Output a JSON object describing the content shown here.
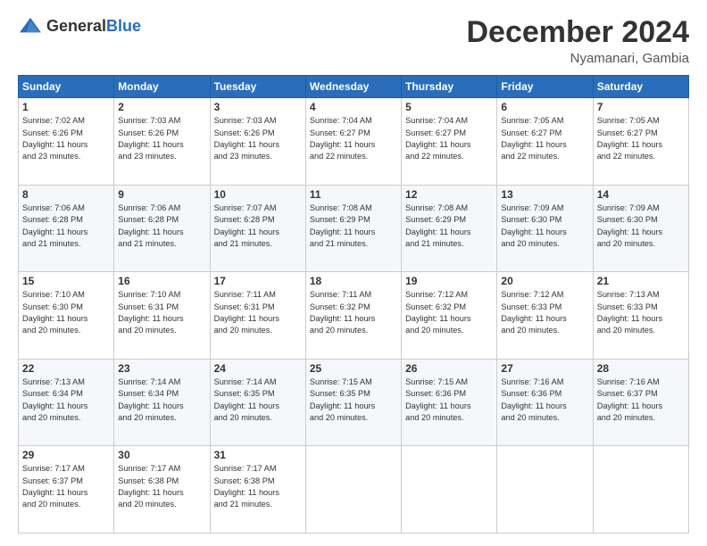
{
  "logo": {
    "general": "General",
    "blue": "Blue"
  },
  "header": {
    "month": "December 2024",
    "location": "Nyamanari, Gambia"
  },
  "weekdays": [
    "Sunday",
    "Monday",
    "Tuesday",
    "Wednesday",
    "Thursday",
    "Friday",
    "Saturday"
  ],
  "weeks": [
    [
      {
        "day": "1",
        "info": "Sunrise: 7:02 AM\nSunset: 6:26 PM\nDaylight: 11 hours\nand 23 minutes."
      },
      {
        "day": "2",
        "info": "Sunrise: 7:03 AM\nSunset: 6:26 PM\nDaylight: 11 hours\nand 23 minutes."
      },
      {
        "day": "3",
        "info": "Sunrise: 7:03 AM\nSunset: 6:26 PM\nDaylight: 11 hours\nand 23 minutes."
      },
      {
        "day": "4",
        "info": "Sunrise: 7:04 AM\nSunset: 6:27 PM\nDaylight: 11 hours\nand 22 minutes."
      },
      {
        "day": "5",
        "info": "Sunrise: 7:04 AM\nSunset: 6:27 PM\nDaylight: 11 hours\nand 22 minutes."
      },
      {
        "day": "6",
        "info": "Sunrise: 7:05 AM\nSunset: 6:27 PM\nDaylight: 11 hours\nand 22 minutes."
      },
      {
        "day": "7",
        "info": "Sunrise: 7:05 AM\nSunset: 6:27 PM\nDaylight: 11 hours\nand 22 minutes."
      }
    ],
    [
      {
        "day": "8",
        "info": "Sunrise: 7:06 AM\nSunset: 6:28 PM\nDaylight: 11 hours\nand 21 minutes."
      },
      {
        "day": "9",
        "info": "Sunrise: 7:06 AM\nSunset: 6:28 PM\nDaylight: 11 hours\nand 21 minutes."
      },
      {
        "day": "10",
        "info": "Sunrise: 7:07 AM\nSunset: 6:28 PM\nDaylight: 11 hours\nand 21 minutes."
      },
      {
        "day": "11",
        "info": "Sunrise: 7:08 AM\nSunset: 6:29 PM\nDaylight: 11 hours\nand 21 minutes."
      },
      {
        "day": "12",
        "info": "Sunrise: 7:08 AM\nSunset: 6:29 PM\nDaylight: 11 hours\nand 21 minutes."
      },
      {
        "day": "13",
        "info": "Sunrise: 7:09 AM\nSunset: 6:30 PM\nDaylight: 11 hours\nand 20 minutes."
      },
      {
        "day": "14",
        "info": "Sunrise: 7:09 AM\nSunset: 6:30 PM\nDaylight: 11 hours\nand 20 minutes."
      }
    ],
    [
      {
        "day": "15",
        "info": "Sunrise: 7:10 AM\nSunset: 6:30 PM\nDaylight: 11 hours\nand 20 minutes."
      },
      {
        "day": "16",
        "info": "Sunrise: 7:10 AM\nSunset: 6:31 PM\nDaylight: 11 hours\nand 20 minutes."
      },
      {
        "day": "17",
        "info": "Sunrise: 7:11 AM\nSunset: 6:31 PM\nDaylight: 11 hours\nand 20 minutes."
      },
      {
        "day": "18",
        "info": "Sunrise: 7:11 AM\nSunset: 6:32 PM\nDaylight: 11 hours\nand 20 minutes."
      },
      {
        "day": "19",
        "info": "Sunrise: 7:12 AM\nSunset: 6:32 PM\nDaylight: 11 hours\nand 20 minutes."
      },
      {
        "day": "20",
        "info": "Sunrise: 7:12 AM\nSunset: 6:33 PM\nDaylight: 11 hours\nand 20 minutes."
      },
      {
        "day": "21",
        "info": "Sunrise: 7:13 AM\nSunset: 6:33 PM\nDaylight: 11 hours\nand 20 minutes."
      }
    ],
    [
      {
        "day": "22",
        "info": "Sunrise: 7:13 AM\nSunset: 6:34 PM\nDaylight: 11 hours\nand 20 minutes."
      },
      {
        "day": "23",
        "info": "Sunrise: 7:14 AM\nSunset: 6:34 PM\nDaylight: 11 hours\nand 20 minutes."
      },
      {
        "day": "24",
        "info": "Sunrise: 7:14 AM\nSunset: 6:35 PM\nDaylight: 11 hours\nand 20 minutes."
      },
      {
        "day": "25",
        "info": "Sunrise: 7:15 AM\nSunset: 6:35 PM\nDaylight: 11 hours\nand 20 minutes."
      },
      {
        "day": "26",
        "info": "Sunrise: 7:15 AM\nSunset: 6:36 PM\nDaylight: 11 hours\nand 20 minutes."
      },
      {
        "day": "27",
        "info": "Sunrise: 7:16 AM\nSunset: 6:36 PM\nDaylight: 11 hours\nand 20 minutes."
      },
      {
        "day": "28",
        "info": "Sunrise: 7:16 AM\nSunset: 6:37 PM\nDaylight: 11 hours\nand 20 minutes."
      }
    ],
    [
      {
        "day": "29",
        "info": "Sunrise: 7:17 AM\nSunset: 6:37 PM\nDaylight: 11 hours\nand 20 minutes."
      },
      {
        "day": "30",
        "info": "Sunrise: 7:17 AM\nSunset: 6:38 PM\nDaylight: 11 hours\nand 20 minutes."
      },
      {
        "day": "31",
        "info": "Sunrise: 7:17 AM\nSunset: 6:38 PM\nDaylight: 11 hours\nand 21 minutes."
      },
      null,
      null,
      null,
      null
    ]
  ]
}
